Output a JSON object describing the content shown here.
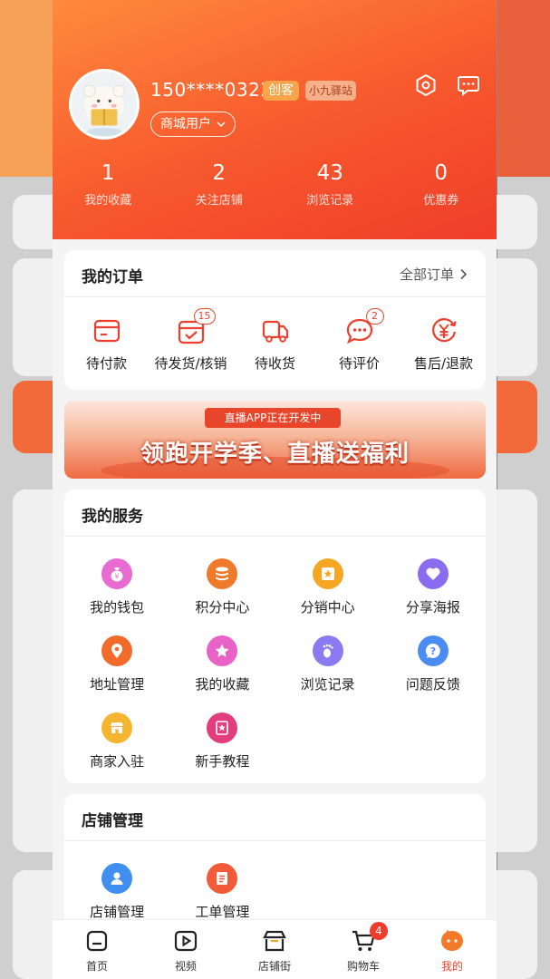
{
  "profile": {
    "phone": "150****0322",
    "badge_creator": "创客",
    "badge_station": "小九驿站",
    "user_type": "商城用户"
  },
  "stats": [
    {
      "value": "1",
      "label": "我的收藏"
    },
    {
      "value": "2",
      "label": "关注店铺"
    },
    {
      "value": "43",
      "label": "浏览记录"
    },
    {
      "value": "0",
      "label": "优惠券"
    }
  ],
  "orders": {
    "title": "我的订单",
    "all_label": "全部订单",
    "items": [
      {
        "label": "待付款",
        "icon": "wallet-card-icon",
        "badge": ""
      },
      {
        "label": "待发货/核销",
        "icon": "calendar-check-icon",
        "badge": "15"
      },
      {
        "label": "待收货",
        "icon": "truck-icon",
        "badge": ""
      },
      {
        "label": "待评价",
        "icon": "chat-bubble-icon",
        "badge": "2"
      },
      {
        "label": "售后/退款",
        "icon": "yen-refund-icon",
        "badge": ""
      }
    ]
  },
  "banner": {
    "tag": "直播APP正在开发中",
    "headline": "领跑开学季、直播送福利"
  },
  "services": {
    "title": "我的服务",
    "items": [
      {
        "label": "我的钱包",
        "icon": "money-bag-icon",
        "color": "#e86bd1"
      },
      {
        "label": "积分中心",
        "icon": "coins-stack-icon",
        "color": "#f07a2c"
      },
      {
        "label": "分销中心",
        "icon": "distribution-icon",
        "color": "#f5a623"
      },
      {
        "label": "分享海报",
        "icon": "heart-icon",
        "color": "#8a6cf0"
      },
      {
        "label": "地址管理",
        "icon": "location-pin-icon",
        "color": "#f26b2b"
      },
      {
        "label": "我的收藏",
        "icon": "star-icon",
        "color": "#e862c8"
      },
      {
        "label": "浏览记录",
        "icon": "footprint-icon",
        "color": "#8b7bf0"
      },
      {
        "label": "问题反馈",
        "icon": "question-icon",
        "color": "#4a8cf2"
      },
      {
        "label": "商家入驻",
        "icon": "shop-icon",
        "color": "#f5b531"
      },
      {
        "label": "新手教程",
        "icon": "tutorial-icon",
        "color": "#e23d7c"
      }
    ]
  },
  "store": {
    "title": "店铺管理",
    "items": [
      {
        "label": "店铺管理",
        "icon": "person-icon",
        "color": "#3f8ef0"
      },
      {
        "label": "工单管理",
        "icon": "document-icon",
        "color": "#f25a3a"
      }
    ]
  },
  "tabbar": [
    {
      "label": "首页",
      "icon": "home-icon",
      "active": false
    },
    {
      "label": "视频",
      "icon": "video-icon",
      "active": false
    },
    {
      "label": "店铺街",
      "icon": "store-street-icon",
      "active": false
    },
    {
      "label": "购物车",
      "icon": "cart-icon",
      "active": false,
      "badge": "4"
    },
    {
      "label": "我的",
      "icon": "profile-face-icon",
      "active": true
    }
  ]
}
